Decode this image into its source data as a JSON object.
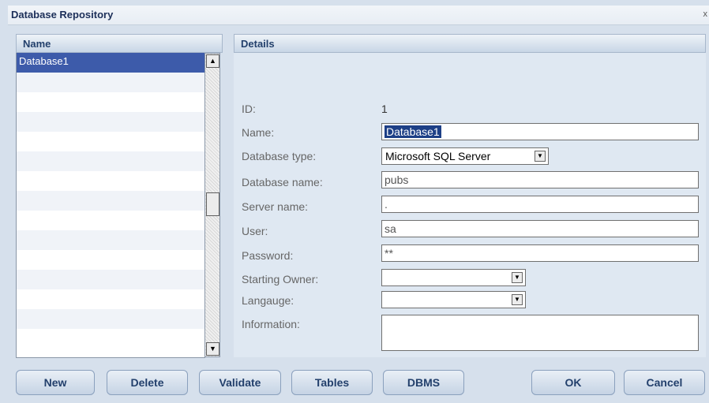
{
  "window": {
    "title": "Database Repository",
    "close_glyph": "x"
  },
  "list_panel": {
    "header": "Name",
    "items": [
      "Database1",
      "",
      "",
      "",
      "",
      "",
      "",
      "",
      "",
      "",
      "",
      "",
      "",
      "",
      ""
    ],
    "scroll_up": "▲",
    "scroll_down": "▼"
  },
  "details": {
    "header": "Details",
    "id_label": "ID:",
    "id_value": "1",
    "name_label": "Name:",
    "name_value": "Database1",
    "dbtype_label": "Database type:",
    "dbtype_value": "Microsoft SQL Server",
    "dbname_label": "Database name:",
    "dbname_value": "pubs",
    "server_label": "Server name:",
    "server_value": ".",
    "user_label": "User:",
    "user_value": "sa",
    "password_label": "Password:",
    "password_value": "**",
    "owner_label": "Starting Owner:",
    "owner_value": "",
    "language_label": "Langauge:",
    "language_value": "",
    "info_label": "Information:",
    "dropdown_glyph": "▼"
  },
  "buttons": {
    "new": "New",
    "delete": "Delete",
    "validate": "Validate",
    "tables": "Tables",
    "dbms": "DBMS",
    "ok": "OK",
    "cancel": "Cancel"
  }
}
